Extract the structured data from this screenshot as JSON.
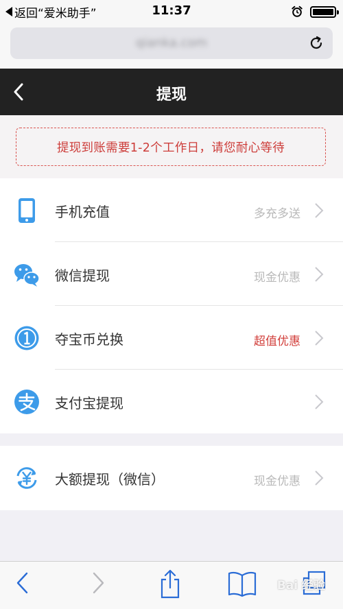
{
  "status_bar": {
    "back_label": "返回“爱米助手”",
    "time": "11:37"
  },
  "browser": {
    "url": "qianka.com"
  },
  "nav": {
    "title": "提现"
  },
  "notice": "提现到账需要1-2个工作日，请您耐心等待",
  "menu": [
    {
      "label": "手机充值",
      "note": "多充多送",
      "icon": "phone-icon"
    },
    {
      "label": "微信提现",
      "note": "现金优惠",
      "icon": "wechat-icon"
    },
    {
      "label": "夺宝币兑换",
      "note": "超值优惠",
      "icon": "coin-icon",
      "note_color": "#d2403c"
    },
    {
      "label": "支付宝提现",
      "note": "",
      "icon": "alipay-icon"
    }
  ],
  "menu2": [
    {
      "label": "大额提现（微信）",
      "note": "现金优惠",
      "icon": "yuan-exchange-icon"
    }
  ],
  "watermark": "Bai 经验",
  "colors": {
    "nav_bg": "#222222",
    "notice_red": "#cd3d3a",
    "icon_blue": "#3d9be9"
  }
}
